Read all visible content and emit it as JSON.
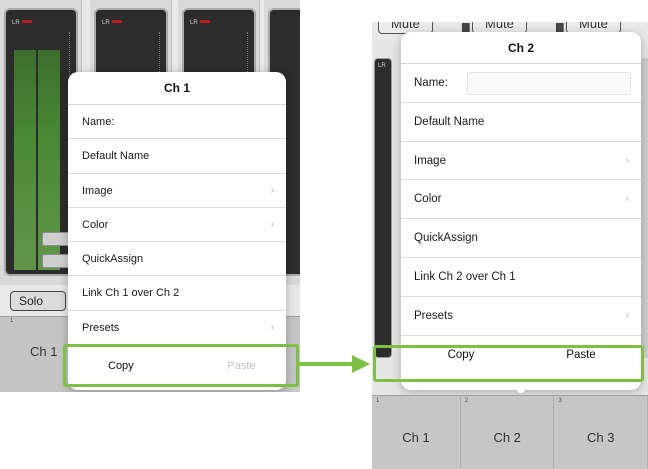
{
  "left": {
    "meter_lr": "LR",
    "solo_label": "Solo",
    "channel_name": "Ch 1",
    "channel_num": "1",
    "popup": {
      "title": "Ch 1",
      "items": [
        {
          "label": "Name:"
        },
        {
          "label": "Default Name"
        },
        {
          "label": "Image"
        },
        {
          "label": "Color"
        },
        {
          "label": "QuickAssign"
        },
        {
          "label": "Link Ch 1 over Ch 2"
        },
        {
          "label": "Presets"
        }
      ],
      "copy_label": "Copy",
      "paste_label": "Paste"
    }
  },
  "right": {
    "mute_labels": [
      "Mute",
      "Mute",
      "Mute"
    ],
    "meter_lr": "LR",
    "popup": {
      "title": "Ch 2",
      "items": [
        {
          "label": "Name:"
        },
        {
          "label": "Default Name"
        },
        {
          "label": "Image"
        },
        {
          "label": "Color"
        },
        {
          "label": "QuickAssign"
        },
        {
          "label": "Link Ch 2 over Ch 1"
        },
        {
          "label": "Presets"
        }
      ],
      "copy_label": "Copy",
      "paste_label": "Paste"
    },
    "channels": [
      {
        "num": "1",
        "name": "Ch 1"
      },
      {
        "num": "2",
        "name": "Ch 2"
      },
      {
        "num": "3",
        "name": "Ch 3"
      }
    ]
  },
  "colors": {
    "highlight": "#7dc143"
  }
}
